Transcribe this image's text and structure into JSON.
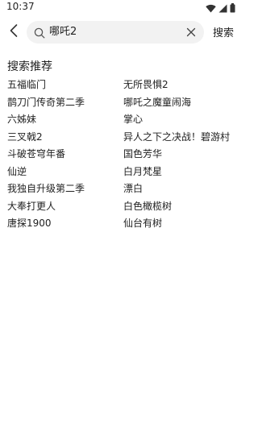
{
  "status_bar": {
    "time": "10:37",
    "icons": [
      "wifi-icon",
      "cellular-signal-icon",
      "battery-icon"
    ]
  },
  "search": {
    "back_icon": "chevron-left-icon",
    "search_icon": "search-icon",
    "query": "哪吒2",
    "clear_icon": "close-icon",
    "submit_label": "搜索"
  },
  "suggestions": {
    "title": "搜索推荐",
    "items": [
      "五福临门",
      "无所畏惧2",
      "鹊刀门传奇第二季",
      "哪吒之魔童闹海",
      "六姊妹",
      "掌心",
      "三叉戟2",
      "异人之下之决战！碧游村",
      "斗破苍穹年番",
      "国色芳华",
      "仙逆",
      "白月梵星",
      "我独自升级第二季",
      "漂白",
      "大奉打更人",
      "白色橄榄树",
      "唐探1900",
      "仙台有树"
    ]
  }
}
